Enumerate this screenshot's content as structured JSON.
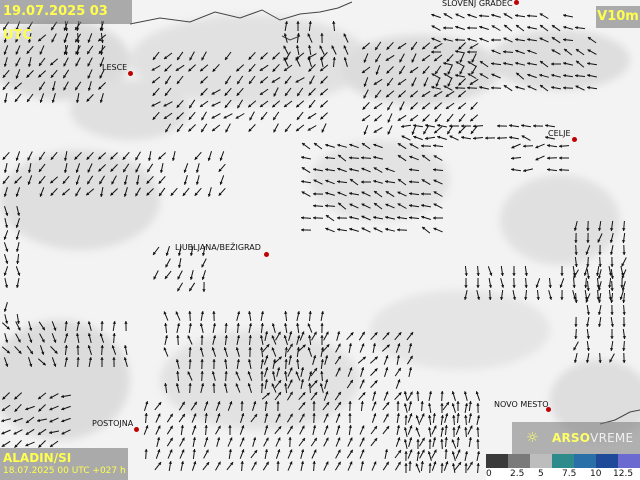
{
  "header": {
    "datetime": "19.07.2025 03 UTC",
    "variable": "V10m"
  },
  "model": {
    "name": "ALADIN/SI",
    "run": "18.07.2025 00 UTC +027 h"
  },
  "brand": {
    "part1": "ARSO",
    "part2": "VREME",
    "icon": "sun-icon"
  },
  "cities": [
    {
      "id": "slovenj-gradec",
      "name": "SLOVENJ GRADEC"
    },
    {
      "id": "lesce",
      "name": "LESCE"
    },
    {
      "id": "celje",
      "name": "CELJE"
    },
    {
      "id": "ljubljana-bezigrad",
      "name": "LJUBLJANA/BEŽIGRAD"
    },
    {
      "id": "novo-mesto",
      "name": "NOVO MESTO"
    },
    {
      "id": "postojna",
      "name": "POSTOJNA"
    }
  ],
  "legend": {
    "labels": [
      "0",
      "2.5",
      "5",
      "7.5",
      "10",
      "12.5"
    ],
    "colors": [
      "#3a3a3a",
      "#7a7a7a",
      "#bdbdbd",
      "#2e8b8b",
      "#2a6fa8",
      "#1f4a9a",
      "#6a6ad0"
    ]
  }
}
